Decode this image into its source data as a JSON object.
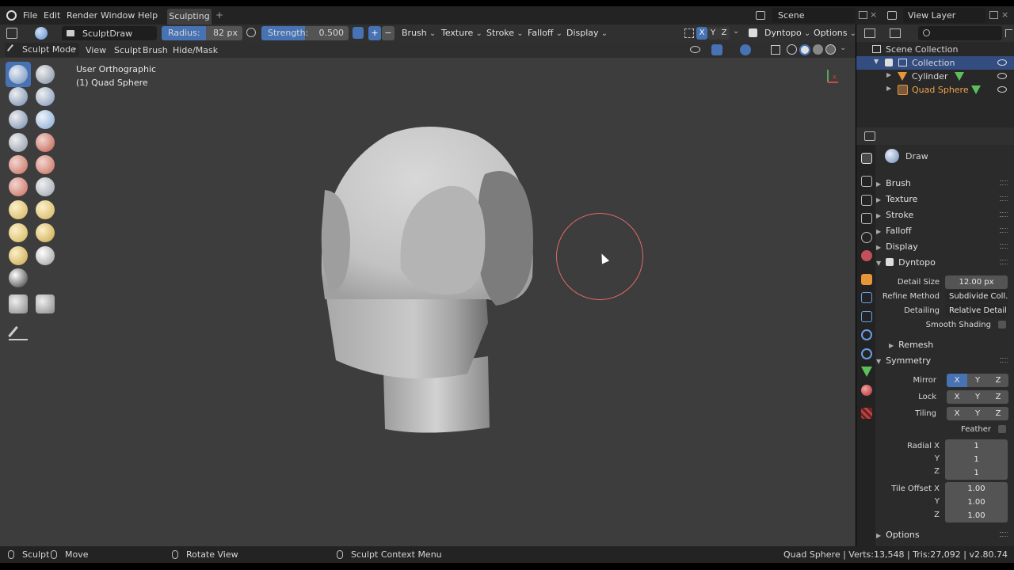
{
  "topbar": {
    "menus": [
      "File",
      "Edit",
      "Render",
      "Window",
      "Help"
    ],
    "active_tab": "Sculpting",
    "add_tab": "+",
    "scene_label": "Scene",
    "view_layer_label": "View Layer"
  },
  "tool_header": {
    "brush_name": "SculptDraw",
    "radius_label": "Radius:",
    "radius_value": "82 px",
    "strength_label": "Strength:",
    "strength_value": "0.500",
    "plus": "+",
    "minus": "−",
    "menus": [
      "Brush",
      "Texture",
      "Stroke",
      "Falloff",
      "Display"
    ],
    "axes": [
      "X",
      "Y",
      "Z"
    ],
    "dyntopo": "Dyntopo",
    "options": "Options"
  },
  "viewport_header": {
    "mode": "Sculpt Mode",
    "menus": [
      "View",
      "Sculpt",
      "Brush",
      "Hide/Mask"
    ]
  },
  "viewport": {
    "view_name": "User Orthographic",
    "object_name": "(1) Quad Sphere",
    "gizmo_axes": [
      "Y",
      "X"
    ]
  },
  "outliner": {
    "root": "Scene Collection",
    "collection": "Collection",
    "items": [
      {
        "name": "Cylinder",
        "color": "#d6d6d6"
      },
      {
        "name": "Quad Sphere",
        "color": "#f0a54a"
      }
    ]
  },
  "properties": {
    "brush_title": "Draw",
    "panels": [
      "Brush",
      "Texture",
      "Stroke",
      "Falloff",
      "Display"
    ],
    "dyntopo": {
      "title": "Dyntopo",
      "detail_size_label": "Detail Size",
      "detail_size_value": "12.00 px",
      "refine_label": "Refine Method",
      "refine_value": "Subdivide Coll...",
      "detailing_label": "Detailing",
      "detailing_value": "Relative Detail",
      "smooth_label": "Smooth Shading",
      "remesh": "Remesh"
    },
    "symmetry": {
      "title": "Symmetry",
      "mirror_label": "Mirror",
      "lock_label": "Lock",
      "tiling_label": "Tiling",
      "axes": [
        "X",
        "Y",
        "Z"
      ],
      "feather_label": "Feather",
      "radial_x_label": "Radial X",
      "radial_y_label": "Y",
      "radial_z_label": "Z",
      "radial_x": "1",
      "radial_y": "1",
      "radial_z": "1",
      "tile_x_label": "Tile Offset X",
      "tile_y_label": "Y",
      "tile_z_label": "Z",
      "tile_x": "1.00",
      "tile_y": "1.00",
      "tile_z": "1.00"
    },
    "options": "Options"
  },
  "statusbar": {
    "left": "Sculpt",
    "move": "Move",
    "rotate": "Rotate View",
    "context": "Sculpt Context Menu",
    "stats": "Quad Sphere | Verts:13,548 | Tris:27,092 | v2.80.74"
  },
  "colors": {
    "accent": "#4772b3",
    "viewport_bg": "#3d3d3d",
    "brush_circle": "#e06a6a",
    "active_object": "#f0a54a"
  }
}
